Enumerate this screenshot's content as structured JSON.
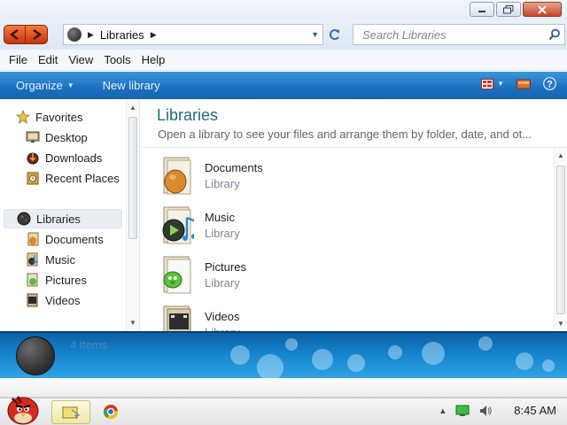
{
  "window": {
    "controls": {
      "minimize": "minimize-icon",
      "maximize": "maximize-icon",
      "close": "close-icon"
    }
  },
  "address": {
    "path": [
      "Libraries"
    ],
    "search_placeholder": "Search Libraries"
  },
  "menu": [
    "File",
    "Edit",
    "View",
    "Tools",
    "Help"
  ],
  "commands": {
    "organize": "Organize",
    "new_library": "New library"
  },
  "nav": {
    "favorites_label": "Favorites",
    "favorites": [
      "Desktop",
      "Downloads",
      "Recent Places"
    ],
    "libraries_label": "Libraries",
    "libraries": [
      "Documents",
      "Music",
      "Pictures",
      "Videos"
    ]
  },
  "content": {
    "title": "Libraries",
    "subtitle": "Open a library to see your files and arrange them by folder, date, and ot...",
    "items": [
      {
        "name": "Documents",
        "type": "Library"
      },
      {
        "name": "Music",
        "type": "Library"
      },
      {
        "name": "Pictures",
        "type": "Library"
      },
      {
        "name": "Videos",
        "type": "Library"
      }
    ]
  },
  "details": {
    "count": "4 items"
  },
  "taskbar": {
    "clock": "8:45 AM"
  },
  "colors": {
    "command_bar": "#1c70bf",
    "nav_buttons": "#e0531f",
    "title_text": "#236a7a"
  }
}
